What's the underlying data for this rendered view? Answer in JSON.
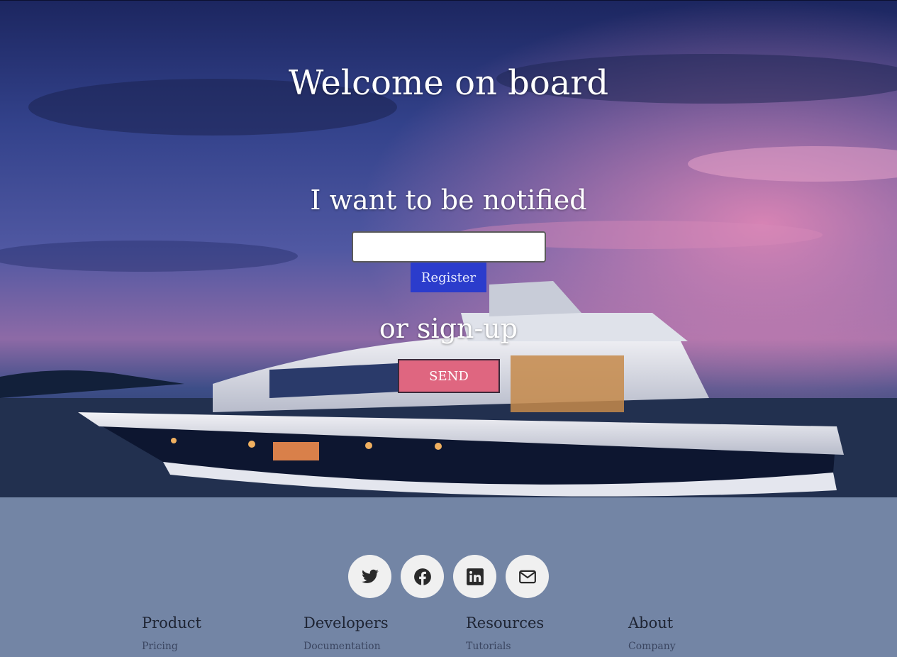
{
  "hero": {
    "title": "Welcome on board",
    "notify_title": "I want to be notified",
    "email_value": "",
    "register_label": "Register",
    "or_title": "or sign-up",
    "send_label": "SEND"
  },
  "footer": {
    "socials": [
      {
        "icon": "twitter-icon"
      },
      {
        "icon": "facebook-icon"
      },
      {
        "icon": "linkedin-icon"
      },
      {
        "icon": "mail-icon"
      }
    ],
    "columns": [
      {
        "heading": "Product",
        "first_link": "Pricing"
      },
      {
        "heading": "Developers",
        "first_link": "Documentation"
      },
      {
        "heading": "Resources",
        "first_link": "Tutorials"
      },
      {
        "heading": "About",
        "first_link": "Company"
      }
    ]
  },
  "colors": {
    "footer_bg": "#7385a5",
    "register_bg": "#2b3ccc",
    "send_bg": "#df6680"
  }
}
